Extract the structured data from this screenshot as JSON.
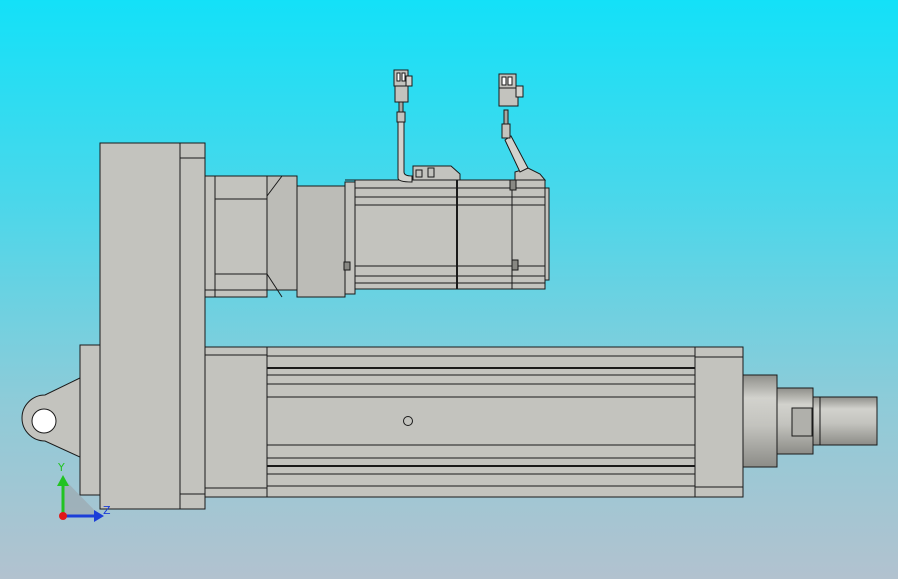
{
  "viewport": {
    "background_top": "#13e1f8",
    "background_bottom": "#b2c2cf"
  },
  "model": {
    "body_fill": "#c3c3be",
    "body_shade": "#a8a8a2",
    "edge_color": "#1a1a1a"
  },
  "triad": {
    "y_label": "Y",
    "z_label": "Z",
    "y_color": "#22c322",
    "z_color": "#1c3ed8",
    "x_color": "#e01818"
  }
}
